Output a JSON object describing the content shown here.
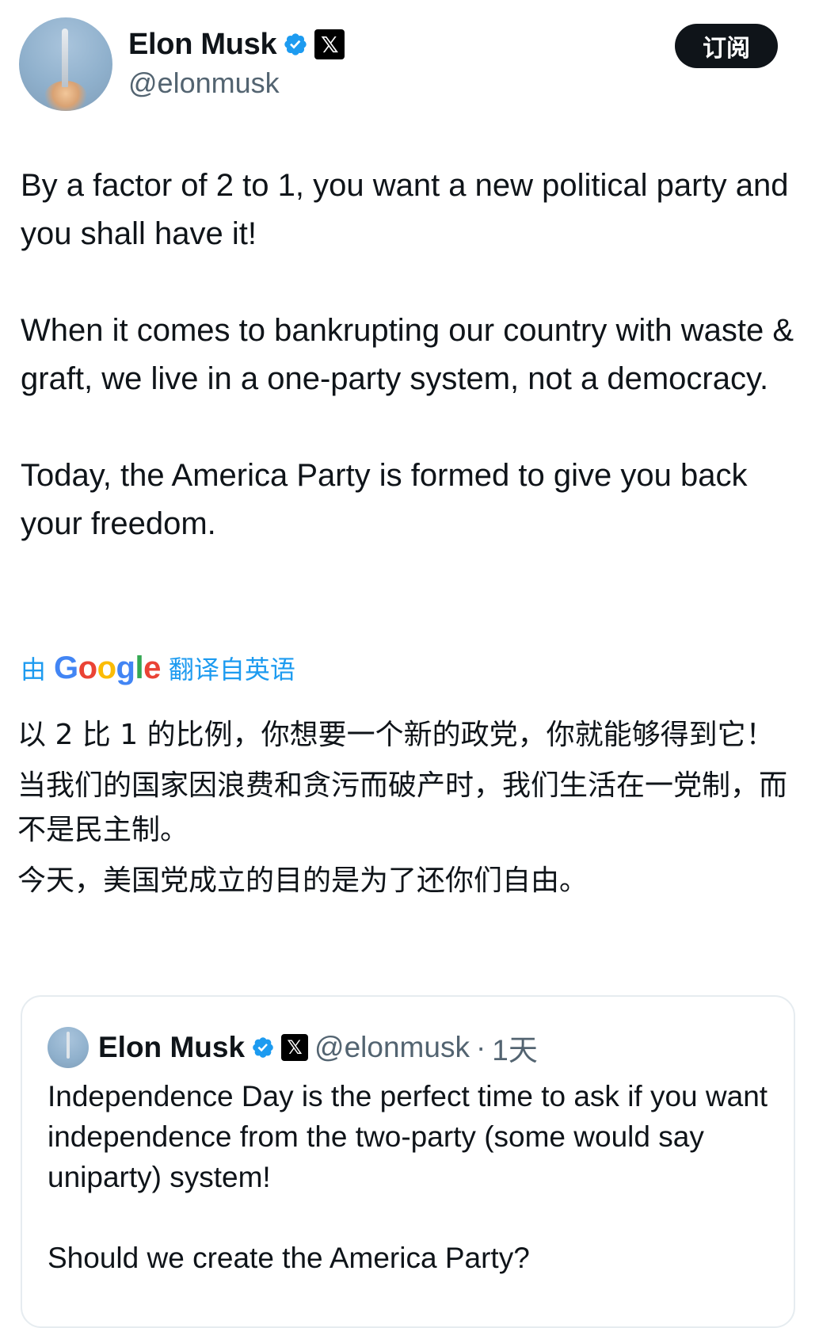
{
  "author": {
    "name": "Elon Musk",
    "handle": "@elonmusk",
    "verified_icon": "verified-badge-icon",
    "affiliation_icon": "x-logo-icon",
    "affiliation_glyph": "𝕏"
  },
  "subscribe_button": {
    "label": "订阅"
  },
  "tweet": {
    "paragraphs": [
      "By a factor of 2 to 1, you want a new political party and you shall have it!",
      "When it comes to bankrupting our country with waste & graft, we live in a one-party system, not a democracy.",
      "Today, the America Party is formed to give you back your freedom."
    ]
  },
  "translation": {
    "prefix": "由",
    "brand": "Google",
    "suffix": "翻译自英语",
    "paragraphs": [
      "以 2 比 1 的比例，你想要一个新的政党，你就能够得到它！",
      "当我们的国家因浪费和贪污而破产时，我们生活在一党制，而不是民主制。",
      "今天，美国党成立的目的是为了还你们自由。"
    ]
  },
  "quoted_tweet": {
    "name": "Elon Musk",
    "handle": "@elonmusk",
    "separator": "·",
    "time": "1天",
    "paragraphs": [
      "Independence Day is the perfect time to ask if you want independence from the two-party (some would say uniparty) system!",
      "Should we create the America Party?"
    ]
  },
  "colors": {
    "accent": "#1d9bf0",
    "text": "#0f1419",
    "secondary": "#536471",
    "button_bg": "#0f1419",
    "border": "#e6ecf0"
  }
}
